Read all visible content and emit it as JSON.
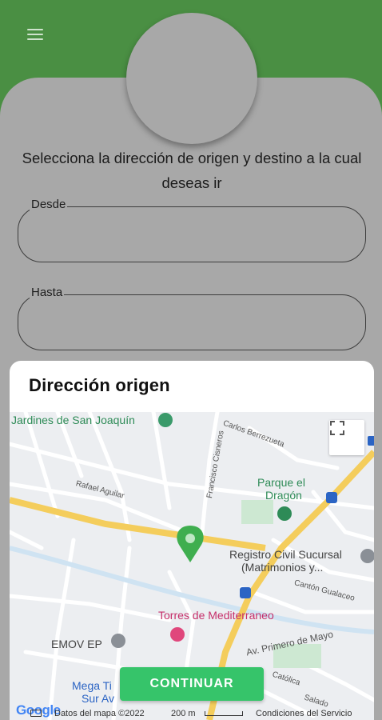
{
  "header": {
    "menu_icon": "hamburger-menu-icon"
  },
  "form": {
    "instruction": "Selecciona la dirección de origen y destino a la cual deseas ir",
    "from_label": "Desde",
    "to_label": "Hasta"
  },
  "modal": {
    "title": "Dirección origen",
    "continue_label": "CONTINUAR"
  },
  "map": {
    "labels": {
      "jardines": "Jardines de San Joaquín",
      "carlos": "Carlos Berrezueta",
      "francisco": "Francisco Cisneros",
      "rafael": "Rafael Aguilar",
      "parque_1": "Parque el",
      "parque_2": "Dragón",
      "registro_1": "Registro Civil Sucursal",
      "registro_2": "(Matrimonios y...",
      "canton": "Cantón Gualaceo",
      "torres": "Torres de Mediterraneo",
      "emov": "EMOV EP",
      "av_primero": "Av. Primero de Mayo",
      "mega_1": "Mega Ti",
      "mega_2": "Sur Av",
      "catolica": "Católica",
      "salado": "Salado"
    },
    "footer": {
      "google": "Google",
      "data": "Datos del mapa ©2022",
      "scale": "200 m",
      "terms": "Condiciones del Servicio"
    }
  },
  "colors": {
    "header_green": "#4a8f43",
    "panel_gray": "#a8a8a8",
    "continue_green": "#36c46a",
    "marker_green": "#3fae4f"
  }
}
